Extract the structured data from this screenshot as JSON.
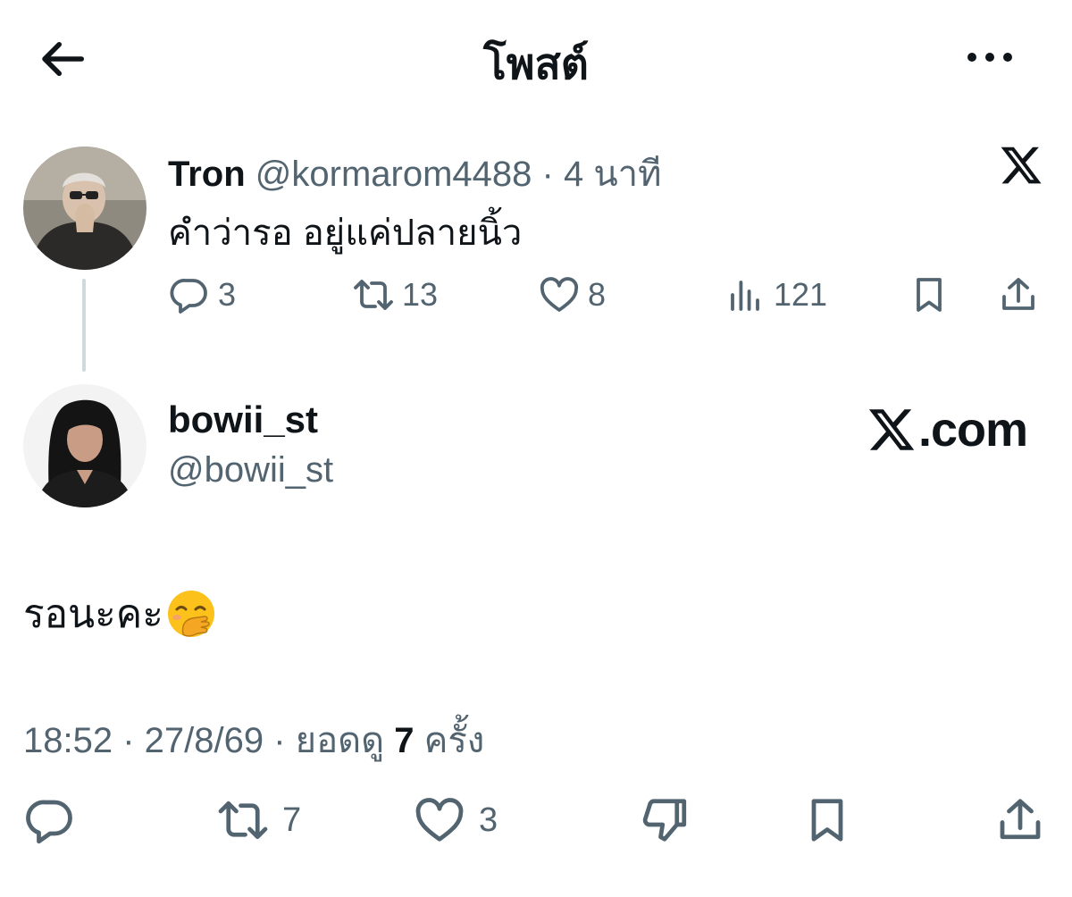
{
  "header": {
    "title": "โพสต์"
  },
  "parent_tweet": {
    "display_name": "Tron",
    "handle": "@kormarom4488",
    "time": "· 4 นาที",
    "text": "คำว่ารอ อยู่แค่ปลายนิ้ว",
    "replies": "3",
    "reposts": "13",
    "likes": "8",
    "views": "121"
  },
  "main_tweet": {
    "display_name": "bowii_st",
    "handle": "@bowii_st",
    "watermark": ".com",
    "text": "รอนะคะ",
    "meta": {
      "time": "18:52",
      "sep1": " · ",
      "date": "27/8/69",
      "sep2": " · ",
      "views_prefix": "ยอดดู ",
      "views": "7",
      "views_suffix": " ครั้ง"
    },
    "reposts": "7",
    "likes": "3"
  },
  "icons": {
    "back": "arrow-left-icon",
    "more": "more-dots-icon",
    "x_logo": "x-logo-icon",
    "reply": "reply-icon",
    "repost": "repost-icon",
    "like": "heart-icon",
    "views": "views-icon",
    "bookmark": "bookmark-icon",
    "share": "share-icon",
    "dislike": "thumbs-down-icon",
    "emoji": "face-with-hand-over-mouth-emoji"
  },
  "colors": {
    "text": "#0f1419",
    "muted": "#536471",
    "thread_line": "#cfd9de"
  }
}
